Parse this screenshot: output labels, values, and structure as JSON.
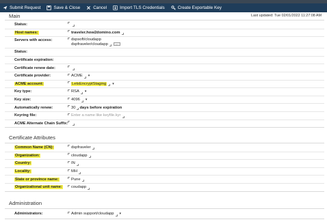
{
  "toolbar": {
    "buttons": [
      {
        "label": "Submit Request",
        "icon": "submit-icon"
      },
      {
        "label": "Save & Close",
        "icon": "save-icon"
      },
      {
        "label": "Cancel",
        "icon": "close-icon"
      },
      {
        "label": "Import TLS Credentials",
        "icon": "import-icon"
      },
      {
        "label": "Create Exportable Key",
        "icon": "key-icon"
      }
    ]
  },
  "main": {
    "title": "Main",
    "last_updated": "Last updated: Tue 02/01/2022 11:27:08 AM",
    "fields": {
      "status_label": "Status:",
      "host_names_label": "Host names:",
      "host_names_value": "traveler.how2domino.com",
      "servers_label": "Servers with access:",
      "servers_value_1": "dspsoft/cloudapp",
      "servers_value_2": "dspfraveler/cloudapp",
      "status2_label": "Status:",
      "cert_expiration_label": "Certificate expiration:",
      "cert_renew_label": "Certificate renew date:",
      "cert_provider_label": "Certificate provider:",
      "cert_provider_value": "ACME",
      "acme_account_label": "ACME account:",
      "acme_account_value": "LetsEncryptStaging",
      "key_type_label": "Key type:",
      "key_type_value": "RSA",
      "key_size_label": "Key size:",
      "key_size_value": "4096",
      "auto_renew_label": "Automatically renew:",
      "auto_renew_value": "30",
      "auto_renew_suffix": "days before expiration",
      "keyring_label": "Keyring file:",
      "keyring_placeholder": "Enter a name like keyfile.kyr",
      "acme_alt_label": "ACME Alternate Chain Suffix:"
    }
  },
  "cert_attributes": {
    "title": "Certificate Attributes",
    "fields": {
      "common_name_label": "Common Name (CN):",
      "common_name_value": "dspfraveler",
      "org_label": "Organization:",
      "org_value": "cloudapp",
      "country_label": "Country:",
      "country_value": "IN",
      "locality_label": "Locality:",
      "locality_value": "MH",
      "state_label": "State or province name:",
      "state_value": "Pune",
      "ou_label": "Organizational unit name:",
      "ou_value": "coudapp"
    }
  },
  "administration": {
    "title": "Administration",
    "administrators_label": "Administrators:",
    "administrators_value": "Admin support/cloudapp"
  },
  "colors": {
    "toolbar_bg": "#1f3d5a",
    "highlight": "#f6f04a"
  }
}
